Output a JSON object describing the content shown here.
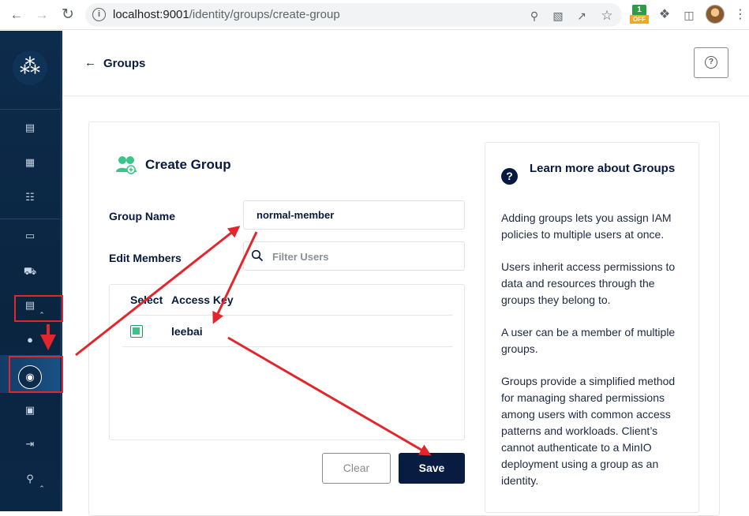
{
  "browser": {
    "url_host": "localhost:9001",
    "url_path": "/identity/groups/create-group",
    "extension_badge": "OFF"
  },
  "header": {
    "back_label": "Groups"
  },
  "form": {
    "title": "Create Group",
    "group_name_label": "Group Name",
    "group_name_value": "normal-member",
    "edit_members_label": "Edit Members",
    "filter_placeholder": "Filter Users",
    "columns": [
      "Select",
      "Access Key"
    ],
    "rows": [
      {
        "access_key": "leebai",
        "selected": true
      }
    ],
    "clear_label": "Clear",
    "save_label": "Save"
  },
  "help": {
    "title": "Learn more about Groups",
    "paragraphs": [
      "Adding groups lets you assign IAM policies to multiple users at once.",
      "Users inherit access permissions to data and resources through the groups they belong to.",
      "A user can be a member of multiple groups.",
      "Groups provide a simplified method for managing shared permissions among users with common access patterns and workloads. Client’s cannot authenticate to a MinIO deployment using a group as an identity."
    ]
  },
  "colors": {
    "sidebar": "#0a2540",
    "primary": "#081c42",
    "checkbox": "#3ac48a",
    "annotation": "#e3262c"
  }
}
